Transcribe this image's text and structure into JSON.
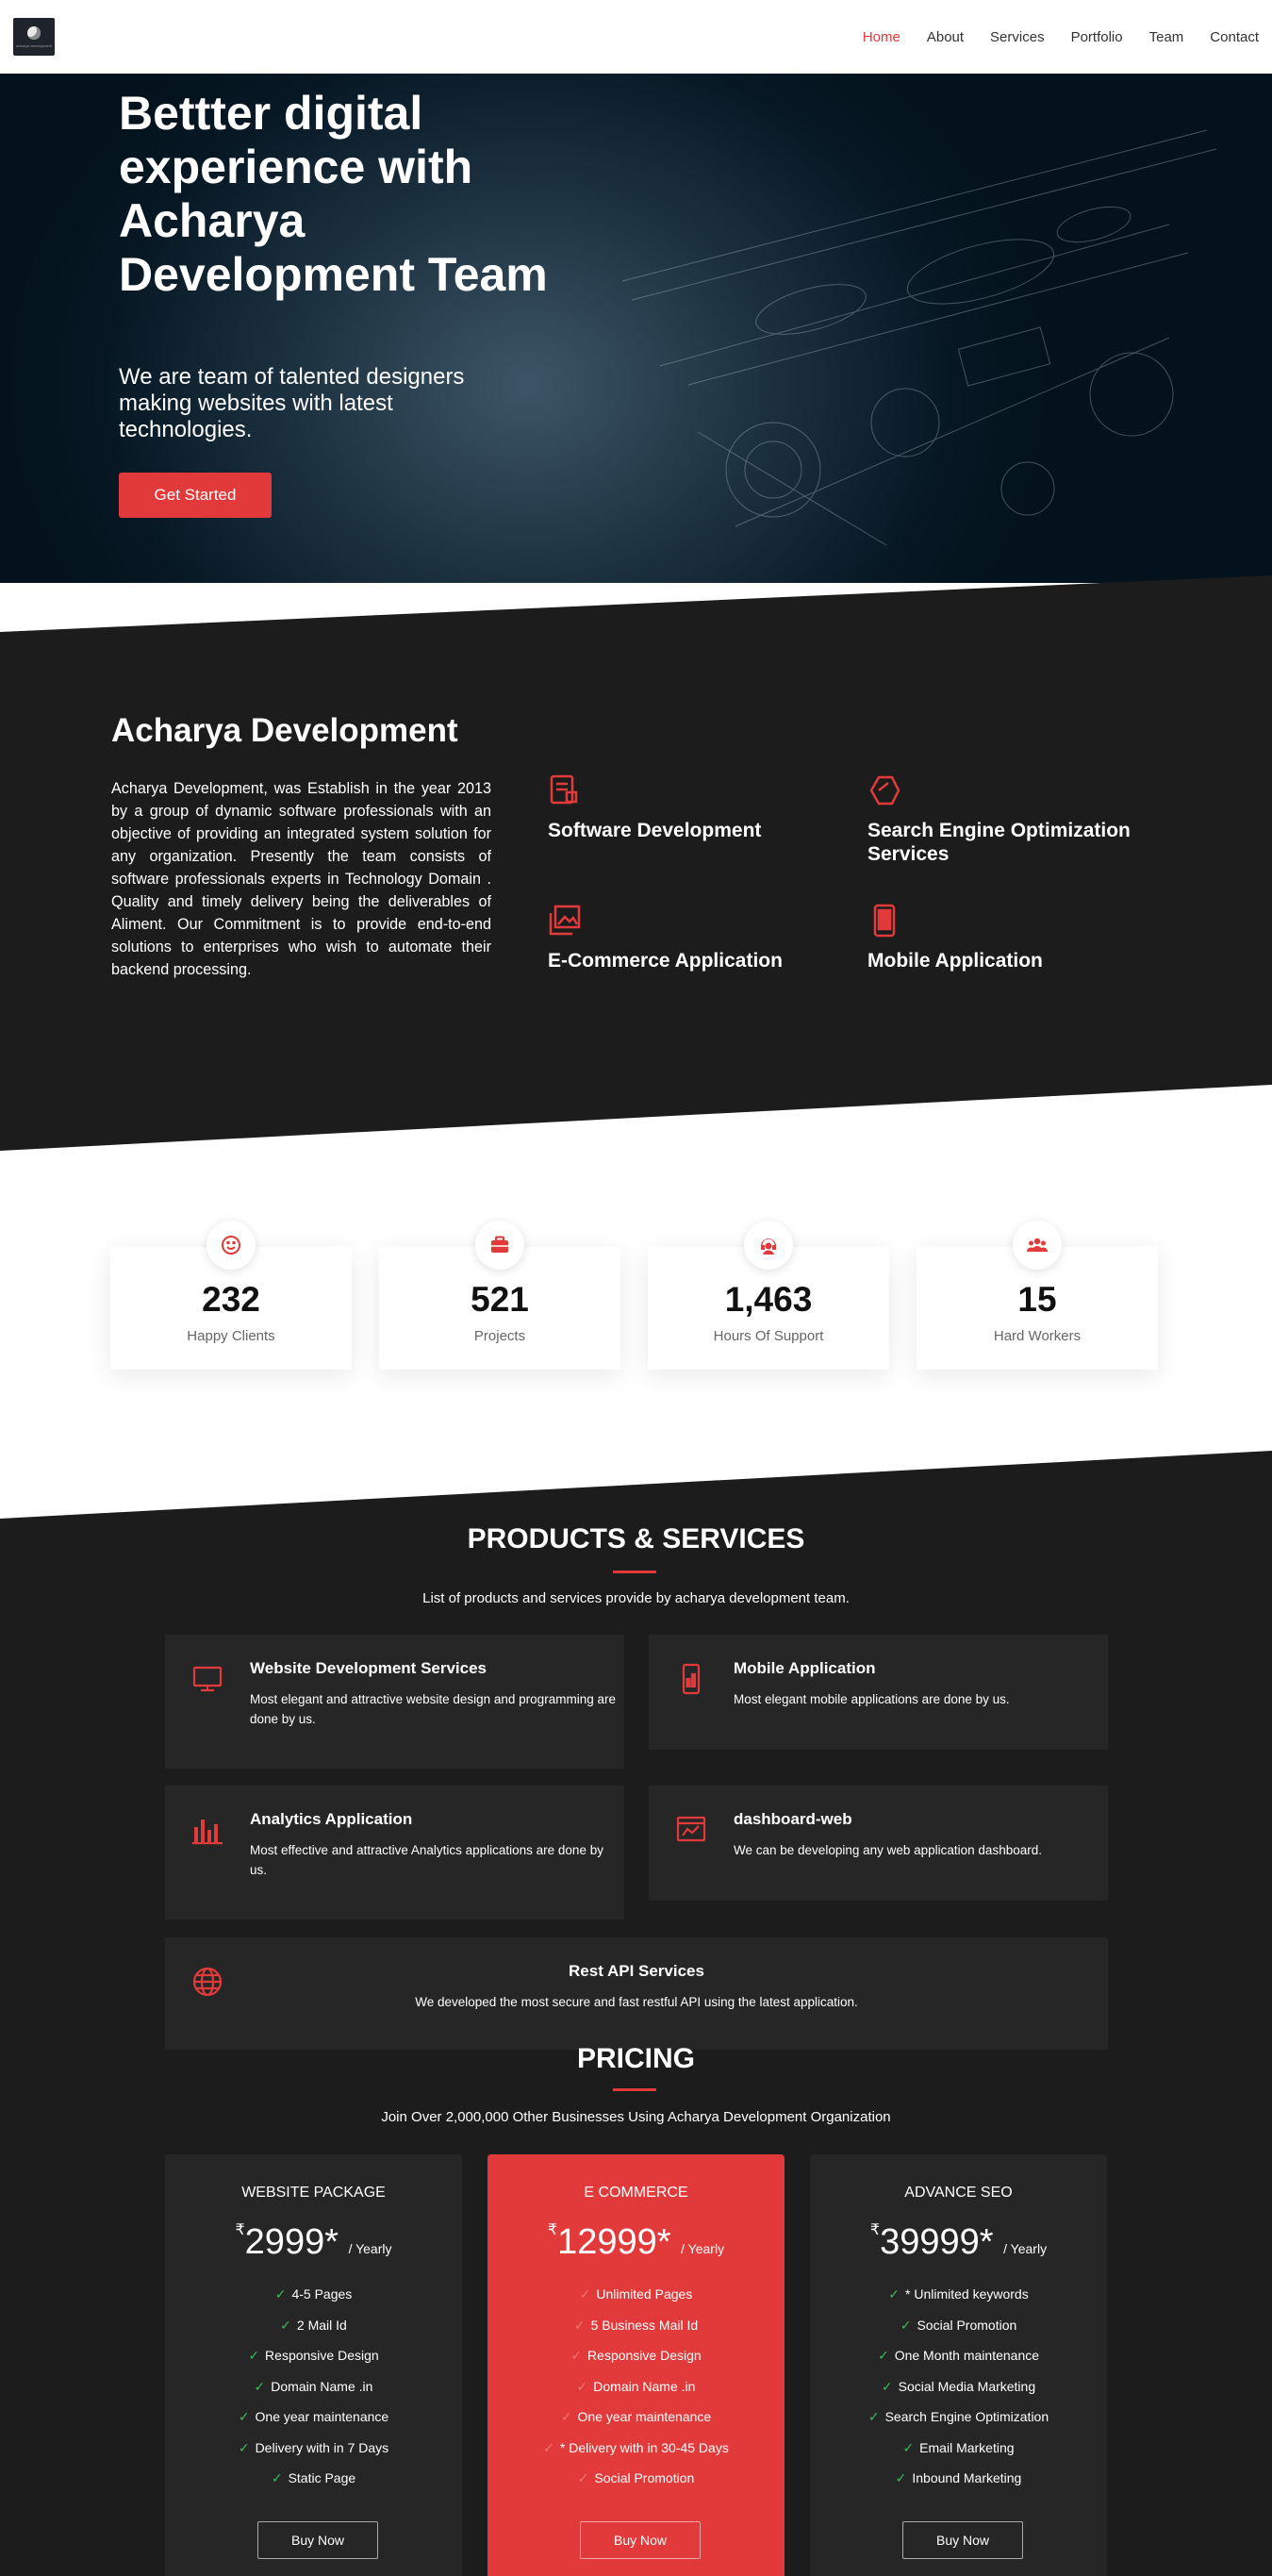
{
  "header": {
    "logo_text": "acharya development",
    "nav": [
      {
        "label": "Home",
        "active": true
      },
      {
        "label": "About",
        "active": false
      },
      {
        "label": "Services",
        "active": false
      },
      {
        "label": "Portfolio",
        "active": false
      },
      {
        "label": "Team",
        "active": false
      },
      {
        "label": "Contact",
        "active": false
      }
    ]
  },
  "hero": {
    "title": "Bettter digital experience with Acharya Development Team",
    "subtitle": "We are team of talented designers making websites with latest technologies.",
    "cta": "Get Started"
  },
  "about": {
    "title": "Acharya Development",
    "text": "Acharya Development, was Establish in the year 2013 by a group of dynamic software professionals with an objective of providing an integrated system solution for any organization. Presently the team consists of software professionals experts in Technology Domain . Quality and timely delivery being the deliverables of Aliment. Our Commitment is to provide end-to-end solutions to enterprises who wish to automate their backend processing.",
    "services": [
      {
        "label": "Software Development",
        "icon": "document-icon"
      },
      {
        "label": "Search Engine Optimization Services",
        "icon": "hexagon-icon"
      },
      {
        "label": "E-Commerce Application",
        "icon": "images-icon"
      },
      {
        "label": "Mobile Application",
        "icon": "phone-icon"
      }
    ]
  },
  "stats": [
    {
      "value": "232",
      "label": "Happy Clients",
      "icon": "smile-icon"
    },
    {
      "value": "521",
      "label": "Projects",
      "icon": "briefcase-icon"
    },
    {
      "value": "1,463",
      "label": "Hours Of Support",
      "icon": "headset-icon"
    },
    {
      "value": "15",
      "label": "Hard Workers",
      "icon": "people-icon"
    }
  ],
  "products": {
    "title": "PRODUCTS & SERVICES",
    "subtitle": "List of products and services provide by acharya development team.",
    "items": [
      {
        "title": "Website Development Services",
        "desc": "Most elegant and attractive website design and programming are done by us.",
        "icon": "monitor-icon"
      },
      {
        "title": "Mobile Application",
        "desc": "Most elegant mobile applications are done by us.",
        "icon": "phone-icon"
      },
      {
        "title": "Analytics Application",
        "desc": "Most effective and attractive Analytics applications are done by us.",
        "icon": "bar-chart-icon"
      },
      {
        "title": "dashboard-web",
        "desc": "We can be developing any web application dashboard.",
        "icon": "dashboard-icon"
      },
      {
        "title": "Rest API Services",
        "desc": "We developed the most secure and fast restful API using the latest application.",
        "icon": "globe-icon"
      }
    ]
  },
  "pricing": {
    "title": "PRICING",
    "subtitle": "Join Over 2,000,000 Other Businesses Using Acharya Development Organization",
    "currency": "₹",
    "period": "/ Yearly",
    "plans": [
      {
        "name": "WEBSITE PACKAGE",
        "price": "2999*",
        "button": "Buy Now",
        "features": [
          "4-5 Pages",
          "2 Mail Id",
          "Responsive Design",
          "Domain Name .in",
          "One year maintenance",
          "Delivery with in 7 Days",
          "Static Page"
        ]
      },
      {
        "name": "E COMMERCE",
        "price": "12999*",
        "button": "Buy Now",
        "features": [
          "Unlimited Pages",
          "5 Business Mail Id",
          "Responsive Design",
          "Domain Name .in",
          "One year maintenance",
          "* Delivery with in 30-45 Days",
          "Social Promotion"
        ]
      },
      {
        "name": "ADVANCE SEO",
        "price": "39999*",
        "button": "Buy Now",
        "features": [
          "* Unlimited keywords",
          "Social Promotion",
          "One Month maintenance",
          "Social Media Marketing",
          "Search Engine Optimization",
          "Email Marketing",
          "Inbound Marketing"
        ]
      }
    ]
  },
  "colors": {
    "accent": "#e23a3a",
    "dark": "#1c1c1d",
    "card": "#262627"
  }
}
